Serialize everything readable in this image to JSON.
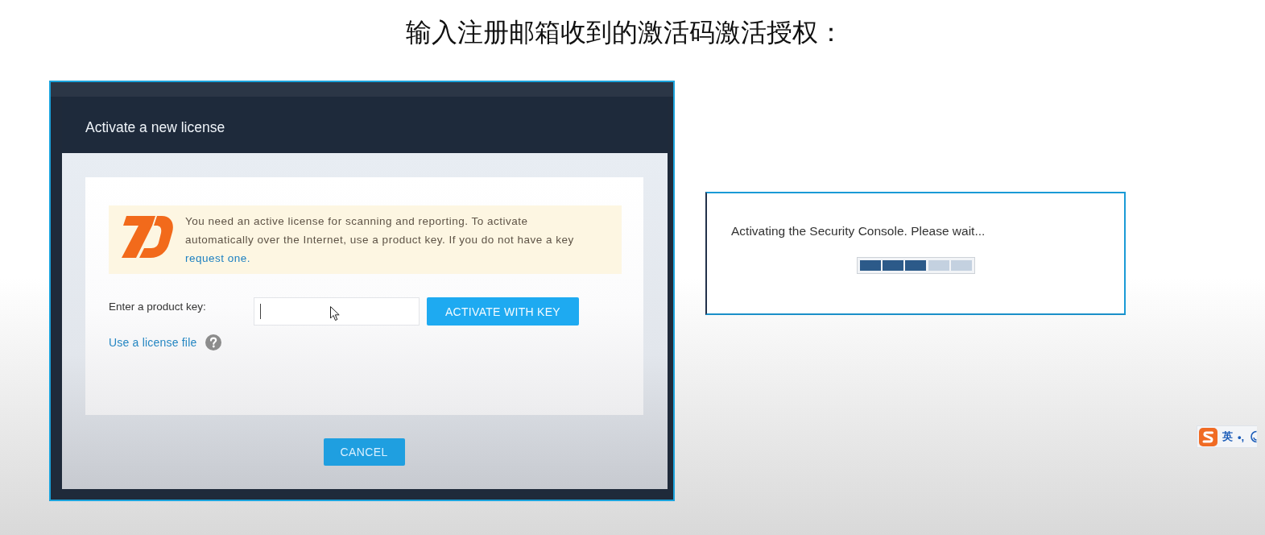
{
  "slide": {
    "title": "输入注册邮箱收到的激活码激活授权："
  },
  "license_dialog": {
    "title": "Activate a new license",
    "notice": {
      "text": "You need an active license for scanning and reporting. To activate automatically over the Internet, use a product key. If you do not have a key",
      "link": "request one."
    },
    "product_key": {
      "label": "Enter a product key:"
    },
    "activate_button": "ACTIVATE WITH KEY",
    "license_file_link": "Use a license file",
    "cancel_button": "CANCEL"
  },
  "progress_dialog": {
    "message": "Activating the Security Console. Please wait...",
    "progress": {
      "level": 0.6
    }
  },
  "ime_toolbar": {
    "mode": "英",
    "punctuation": "•,"
  }
}
